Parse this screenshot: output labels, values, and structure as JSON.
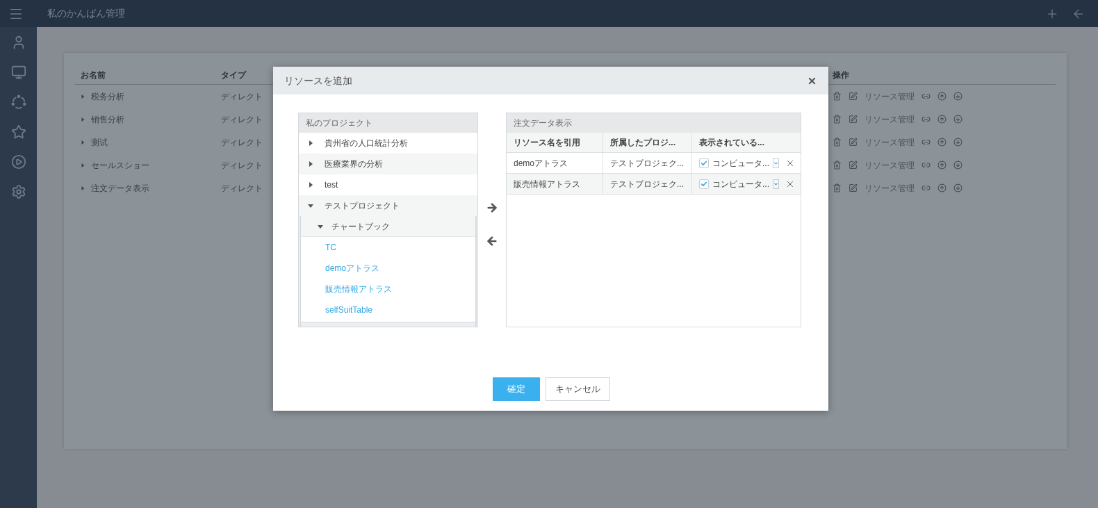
{
  "topbar": {
    "title": "私のかんばん管理"
  },
  "sidebar": {
    "items": [
      {
        "selected": false
      },
      {
        "selected": false
      },
      {
        "selected": false
      },
      {
        "selected": false
      },
      {
        "selected": false
      },
      {
        "selected": false
      }
    ]
  },
  "table": {
    "columns": [
      "お名前",
      "タイプ",
      "操作"
    ],
    "rows": [
      {
        "name": "税务分析",
        "type": "ディレクト",
        "action": "リソース管理"
      },
      {
        "name": "销售分析",
        "type": "ディレクト",
        "action": "リソース管理"
      },
      {
        "name": "测试",
        "type": "ディレクト",
        "action": "リソース管理"
      },
      {
        "name": "セールスショー",
        "type": "ディレクト",
        "action": "リソース管理"
      },
      {
        "name": "注文データ表示",
        "type": "ディレクト",
        "action": "リソース管理"
      }
    ]
  },
  "dialog": {
    "title": "リソースを追加",
    "tree": {
      "title": "私のプロジェクト",
      "items": [
        {
          "label": "貴州省の人口統計分析",
          "expanded": false
        },
        {
          "label": "医療業界の分析",
          "expanded": false
        },
        {
          "label": "test",
          "expanded": false
        },
        {
          "label": "テストプロジェクト",
          "expanded": true,
          "children": [
            {
              "label": "チャートブック",
              "expanded": true,
              "children": [
                {
                  "label": "TC"
                },
                {
                  "label": "demoアトラス"
                },
                {
                  "label": "販売情報アトラス"
                },
                {
                  "label": "selfSuitTable"
                }
              ]
            }
          ]
        }
      ]
    },
    "selected": {
      "title": "注文データ表示",
      "columns": [
        "リソース名を引用",
        "所属したプロジ...",
        "表示されている..."
      ],
      "rows": [
        {
          "name": "demoアトラス",
          "project": "テストプロジェク...",
          "display": "コンピュータ...",
          "checked": true
        },
        {
          "name": "販売情報アトラス",
          "project": "テストプロジェク...",
          "display": "コンピュータ...",
          "checked": true
        }
      ]
    },
    "buttons": [
      {
        "label": "確定",
        "kind": "primary"
      },
      {
        "label": "キャンセル",
        "kind": "secondary"
      }
    ]
  }
}
